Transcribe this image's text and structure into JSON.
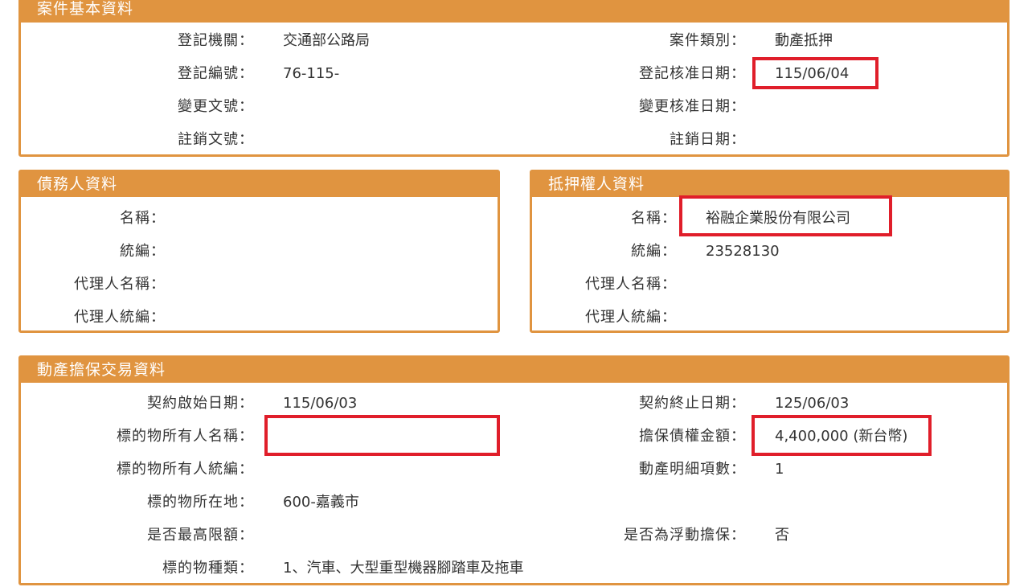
{
  "basic": {
    "title": "案件基本資料",
    "rows_left": [
      {
        "label": "登記機關：",
        "value": "交通部公路局"
      },
      {
        "label": "登記編號：",
        "value": "76-115-"
      },
      {
        "label": "變更文號：",
        "value": ""
      },
      {
        "label": "註銷文號：",
        "value": ""
      }
    ],
    "rows_right": [
      {
        "label": "案件類別：",
        "value": "動產抵押"
      },
      {
        "label": "登記核准日期：",
        "value": "115/06/04"
      },
      {
        "label": "變更核准日期：",
        "value": ""
      },
      {
        "label": "註銷日期：",
        "value": ""
      }
    ]
  },
  "debtor": {
    "title": "債務人資料",
    "rows": [
      {
        "label": "名稱：",
        "value": ""
      },
      {
        "label": "統編：",
        "value": ""
      },
      {
        "label": "代理人名稱：",
        "value": ""
      },
      {
        "label": "代理人統編：",
        "value": ""
      }
    ]
  },
  "mortgagee": {
    "title": "抵押權人資料",
    "rows": [
      {
        "label": "名稱：",
        "value": "裕融企業股份有限公司"
      },
      {
        "label": "統編：",
        "value": "23528130"
      },
      {
        "label": "代理人名稱：",
        "value": ""
      },
      {
        "label": "代理人統編：",
        "value": ""
      }
    ]
  },
  "transaction": {
    "title": "動產擔保交易資料",
    "rows_left": [
      {
        "label": "契約啟始日期：",
        "value": "115/06/03"
      },
      {
        "label": "標的物所有人名稱：",
        "value": ""
      },
      {
        "label": "標的物所有人統編：",
        "value": ""
      },
      {
        "label": "標的物所在地：",
        "value": "600-嘉義市"
      },
      {
        "label": "是否最高限額：",
        "value": ""
      },
      {
        "label": "標的物種類：",
        "value": "1、汽車、大型重型機器腳踏車及拖車"
      }
    ],
    "rows_right": [
      {
        "label": "契約終止日期：",
        "value": "125/06/03"
      },
      {
        "label": "擔保債權金額：",
        "value": "4,400,000 (新台幣)"
      },
      {
        "label": "動產明細項數：",
        "value": "1"
      },
      {
        "label": "",
        "value": ""
      },
      {
        "label": "是否為浮動擔保：",
        "value": "否"
      },
      {
        "label": "",
        "value": ""
      }
    ]
  },
  "colors": {
    "panel_accent": "#e09440",
    "highlight_box": "#e01e2a"
  }
}
